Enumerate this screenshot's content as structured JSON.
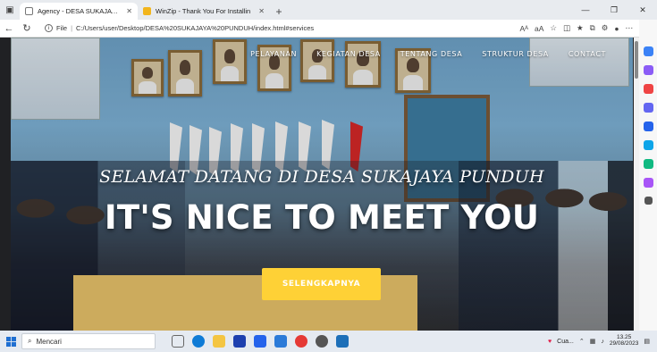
{
  "browser": {
    "tabs": [
      {
        "title": "Agency - DESA SUKAJAYA PUNDU",
        "active": true,
        "icon": "page-icon"
      },
      {
        "title": "WinZip - Thank You For Installin",
        "active": false,
        "icon": "winzip-icon"
      }
    ],
    "address": {
      "scheme_label": "File",
      "url": "C:/Users/user/Desktop/DESA%20SUKAJAYA%20PUNDUH/index.html#services"
    },
    "reader_label": "Aᴬ",
    "translate_label": "aA"
  },
  "site": {
    "nav": [
      "PELAYANAN",
      "KEGIATAN DESA",
      "TENTANG DESA",
      "STRUKTUR DESA",
      "CONTACT"
    ],
    "hero_subheading": "SELAMAT DATANG DI DESA SUKAJAYA PUNDUH",
    "hero_heading": "IT'S NICE TO MEET YOU",
    "cta_label": "SELENGKAPNYA",
    "accent_color": "#fed136"
  },
  "taskbar": {
    "search_placeholder": "Mencari",
    "weather": "Cua...",
    "time": "13.25",
    "date": "29/08/2023"
  }
}
